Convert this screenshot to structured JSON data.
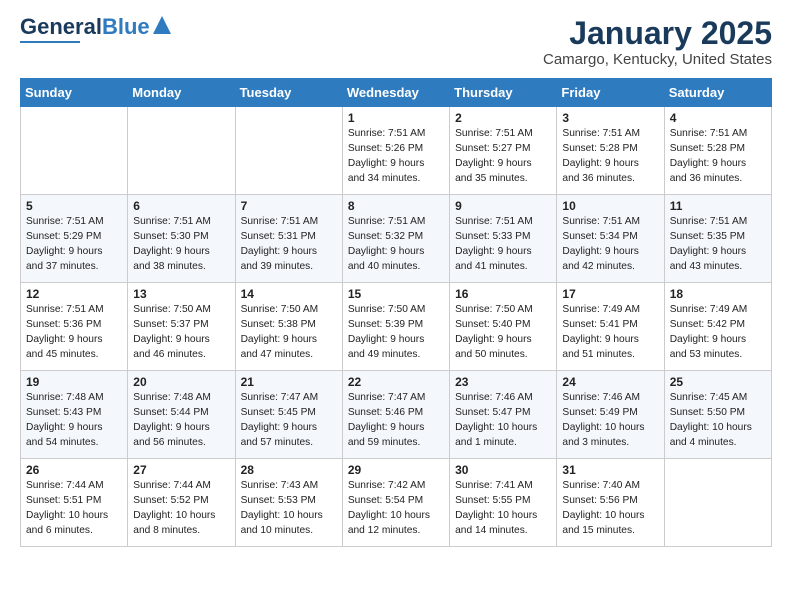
{
  "header": {
    "logo_general": "General",
    "logo_blue": "Blue",
    "month": "January 2025",
    "location": "Camargo, Kentucky, United States"
  },
  "weekdays": [
    "Sunday",
    "Monday",
    "Tuesday",
    "Wednesday",
    "Thursday",
    "Friday",
    "Saturday"
  ],
  "weeks": [
    [
      {
        "day": "",
        "info": ""
      },
      {
        "day": "",
        "info": ""
      },
      {
        "day": "",
        "info": ""
      },
      {
        "day": "1",
        "info": "Sunrise: 7:51 AM\nSunset: 5:26 PM\nDaylight: 9 hours\nand 34 minutes."
      },
      {
        "day": "2",
        "info": "Sunrise: 7:51 AM\nSunset: 5:27 PM\nDaylight: 9 hours\nand 35 minutes."
      },
      {
        "day": "3",
        "info": "Sunrise: 7:51 AM\nSunset: 5:28 PM\nDaylight: 9 hours\nand 36 minutes."
      },
      {
        "day": "4",
        "info": "Sunrise: 7:51 AM\nSunset: 5:28 PM\nDaylight: 9 hours\nand 36 minutes."
      }
    ],
    [
      {
        "day": "5",
        "info": "Sunrise: 7:51 AM\nSunset: 5:29 PM\nDaylight: 9 hours\nand 37 minutes."
      },
      {
        "day": "6",
        "info": "Sunrise: 7:51 AM\nSunset: 5:30 PM\nDaylight: 9 hours\nand 38 minutes."
      },
      {
        "day": "7",
        "info": "Sunrise: 7:51 AM\nSunset: 5:31 PM\nDaylight: 9 hours\nand 39 minutes."
      },
      {
        "day": "8",
        "info": "Sunrise: 7:51 AM\nSunset: 5:32 PM\nDaylight: 9 hours\nand 40 minutes."
      },
      {
        "day": "9",
        "info": "Sunrise: 7:51 AM\nSunset: 5:33 PM\nDaylight: 9 hours\nand 41 minutes."
      },
      {
        "day": "10",
        "info": "Sunrise: 7:51 AM\nSunset: 5:34 PM\nDaylight: 9 hours\nand 42 minutes."
      },
      {
        "day": "11",
        "info": "Sunrise: 7:51 AM\nSunset: 5:35 PM\nDaylight: 9 hours\nand 43 minutes."
      }
    ],
    [
      {
        "day": "12",
        "info": "Sunrise: 7:51 AM\nSunset: 5:36 PM\nDaylight: 9 hours\nand 45 minutes."
      },
      {
        "day": "13",
        "info": "Sunrise: 7:50 AM\nSunset: 5:37 PM\nDaylight: 9 hours\nand 46 minutes."
      },
      {
        "day": "14",
        "info": "Sunrise: 7:50 AM\nSunset: 5:38 PM\nDaylight: 9 hours\nand 47 minutes."
      },
      {
        "day": "15",
        "info": "Sunrise: 7:50 AM\nSunset: 5:39 PM\nDaylight: 9 hours\nand 49 minutes."
      },
      {
        "day": "16",
        "info": "Sunrise: 7:50 AM\nSunset: 5:40 PM\nDaylight: 9 hours\nand 50 minutes."
      },
      {
        "day": "17",
        "info": "Sunrise: 7:49 AM\nSunset: 5:41 PM\nDaylight: 9 hours\nand 51 minutes."
      },
      {
        "day": "18",
        "info": "Sunrise: 7:49 AM\nSunset: 5:42 PM\nDaylight: 9 hours\nand 53 minutes."
      }
    ],
    [
      {
        "day": "19",
        "info": "Sunrise: 7:48 AM\nSunset: 5:43 PM\nDaylight: 9 hours\nand 54 minutes."
      },
      {
        "day": "20",
        "info": "Sunrise: 7:48 AM\nSunset: 5:44 PM\nDaylight: 9 hours\nand 56 minutes."
      },
      {
        "day": "21",
        "info": "Sunrise: 7:47 AM\nSunset: 5:45 PM\nDaylight: 9 hours\nand 57 minutes."
      },
      {
        "day": "22",
        "info": "Sunrise: 7:47 AM\nSunset: 5:46 PM\nDaylight: 9 hours\nand 59 minutes."
      },
      {
        "day": "23",
        "info": "Sunrise: 7:46 AM\nSunset: 5:47 PM\nDaylight: 10 hours\nand 1 minute."
      },
      {
        "day": "24",
        "info": "Sunrise: 7:46 AM\nSunset: 5:49 PM\nDaylight: 10 hours\nand 3 minutes."
      },
      {
        "day": "25",
        "info": "Sunrise: 7:45 AM\nSunset: 5:50 PM\nDaylight: 10 hours\nand 4 minutes."
      }
    ],
    [
      {
        "day": "26",
        "info": "Sunrise: 7:44 AM\nSunset: 5:51 PM\nDaylight: 10 hours\nand 6 minutes."
      },
      {
        "day": "27",
        "info": "Sunrise: 7:44 AM\nSunset: 5:52 PM\nDaylight: 10 hours\nand 8 minutes."
      },
      {
        "day": "28",
        "info": "Sunrise: 7:43 AM\nSunset: 5:53 PM\nDaylight: 10 hours\nand 10 minutes."
      },
      {
        "day": "29",
        "info": "Sunrise: 7:42 AM\nSunset: 5:54 PM\nDaylight: 10 hours\nand 12 minutes."
      },
      {
        "day": "30",
        "info": "Sunrise: 7:41 AM\nSunset: 5:55 PM\nDaylight: 10 hours\nand 14 minutes."
      },
      {
        "day": "31",
        "info": "Sunrise: 7:40 AM\nSunset: 5:56 PM\nDaylight: 10 hours\nand 15 minutes."
      },
      {
        "day": "",
        "info": ""
      }
    ]
  ]
}
